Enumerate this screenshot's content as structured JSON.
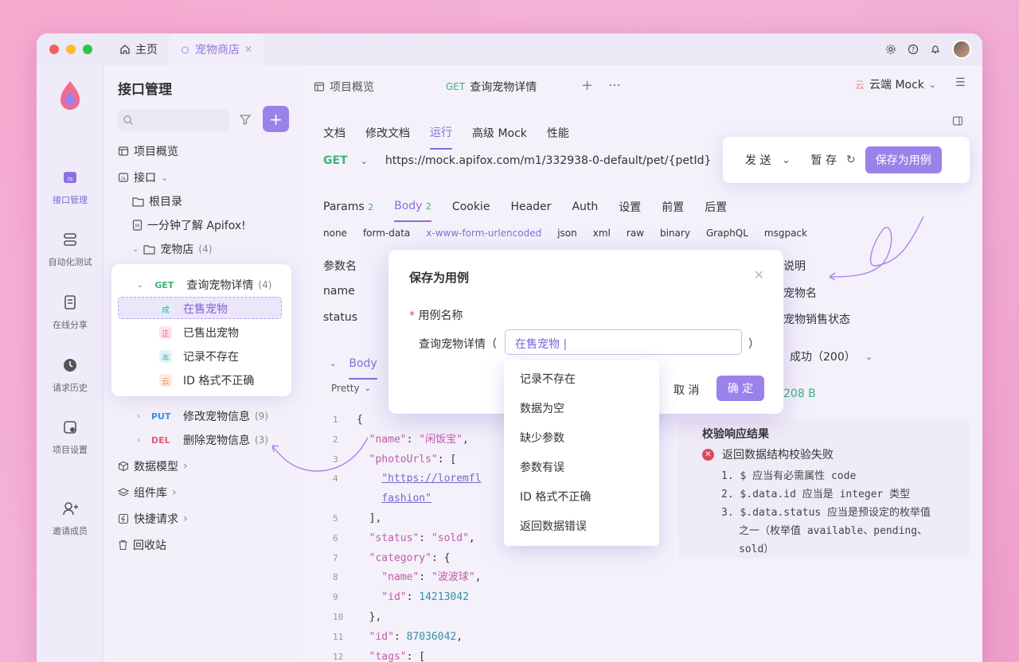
{
  "window": {
    "home_tab": "主页",
    "active_tab": "宠物商店"
  },
  "rail": [
    {
      "label": "接口管理",
      "icon": "api-icon"
    },
    {
      "label": "自动化测试",
      "icon": "automation-icon"
    },
    {
      "label": "在线分享",
      "icon": "share-icon"
    },
    {
      "label": "请求历史",
      "icon": "history-icon"
    },
    {
      "label": "项目设置",
      "icon": "settings-icon"
    },
    {
      "label": "邀请成员",
      "icon": "invite-icon"
    }
  ],
  "tree": {
    "title": "接口管理",
    "items": {
      "overview": "项目概览",
      "api": "接口",
      "root": "根目录",
      "intro": "一分钟了解 Apifox!",
      "petstore": "宠物店",
      "petstore_count": "(4)",
      "get_method": "GET",
      "get_label": "查询宠物详情",
      "get_count": "(4)",
      "case1": "在售宠物",
      "case1_badge": "成",
      "case2": "已售出宠物",
      "case2_badge": "正",
      "case3": "记录不存在",
      "case3_badge": "本",
      "case4": "ID 格式不正确",
      "case4_badge": "云",
      "put_method": "PUT",
      "put_label": "修改宠物信息",
      "put_count": "(9)",
      "del_method": "DEL",
      "del_label": "删除宠物信息",
      "del_count": "(3)",
      "models": "数据模型",
      "components": "组件库",
      "quick": "快捷请求",
      "trash": "回收站"
    }
  },
  "main": {
    "tab_overview": "项目概览",
    "tab_method": "GET",
    "tab_label": "查询宠物详情",
    "env": "云端 Mock",
    "env_badge": "云",
    "subtabs": [
      "文档",
      "修改文档",
      "运行",
      "高级 Mock",
      "性能"
    ],
    "method": "GET",
    "url": "https://mock.apifox.com/m1/332938-0-default/pet/{petId}",
    "send": "发 送",
    "pause": "暂 存",
    "save_case": "保存为用例",
    "req_tabs": [
      "Params",
      "Body",
      "Cookie",
      "Header",
      "Auth",
      "设置",
      "前置",
      "后置"
    ],
    "params_count": "2",
    "body_count": "2",
    "body_types": [
      "none",
      "form-data",
      "x-www-form-urlencoded",
      "json",
      "xml",
      "raw",
      "binary",
      "GraphQL",
      "msgpack"
    ],
    "param_header": "参数名",
    "param_desc_header": "说明",
    "rows": [
      {
        "name": "name",
        "desc": "宠物名"
      },
      {
        "name": "status",
        "desc": "宠物销售状态"
      }
    ],
    "resp_body": "Body",
    "pretty": "Pretty",
    "resp_status": "成功（200）",
    "resp_size": "208 B",
    "validate_title": "校验响应结果",
    "validate_fail": "返回数据结构校验失败",
    "errors": [
      "1. $ 应当有必需属性 code",
      "2. $.data.id 应当是 integer 类型",
      "3. $.data.status 应当是预设定的枚举值",
      "之一（枚举值 available、pending、",
      "sold）"
    ]
  },
  "modal": {
    "title": "保存为用例",
    "field_label": "用例名称",
    "prefix": "查询宠物详情（",
    "value": "在售宠物",
    "suffix": "）",
    "cancel": "取 消",
    "ok": "确 定"
  },
  "dropdown": [
    "记录不存在",
    "数据为空",
    "缺少参数",
    "参数有误",
    "ID 格式不正确",
    "返回数据错误"
  ],
  "code": {
    "l1": "{",
    "name_k": "\"name\"",
    "name_v": "\"闲饭宝\"",
    "photo_k": "\"photoUrls\"",
    "photo_v1": "\"https://loremfl",
    "photo_v2": "fashion\"",
    "status_k": "\"status\"",
    "status_v": "\"sold\"",
    "cat_k": "\"category\"",
    "cname_k": "\"name\"",
    "cname_v": "\"波波球\"",
    "cid_k": "\"id\"",
    "cid_v": "14213042",
    "id_k": "\"id\"",
    "id_v": "87036042",
    "tags_k": "\"tags\""
  }
}
